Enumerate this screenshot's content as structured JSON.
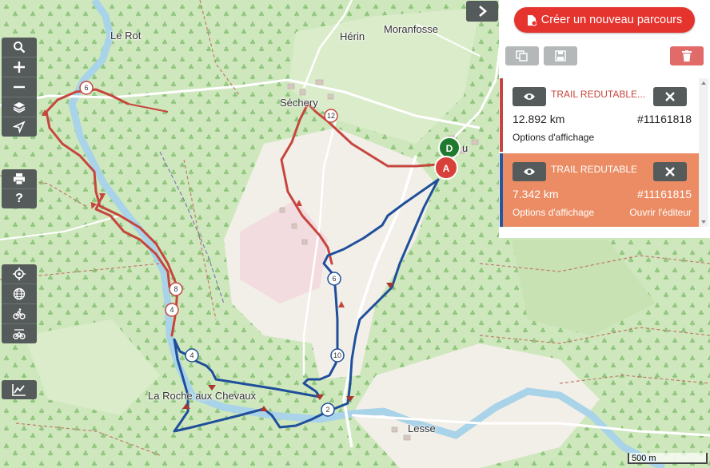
{
  "places": {
    "le_rot": "Le Rot",
    "herin": "Hérin",
    "moranfosse": "Moranfosse",
    "sechery": "Séchery",
    "la_roche": "La Roche aux Chevaux",
    "lesse": "Lesse",
    "u": "u"
  },
  "markers": {
    "start": "D",
    "end": "A"
  },
  "km_markers": {
    "red": [
      "6",
      "8",
      "12"
    ],
    "blue": [
      "2",
      "4",
      "6",
      "10"
    ],
    "shared": "4"
  },
  "toolbar": {
    "search": "search-icon",
    "zoom_in": "plus-icon",
    "zoom_out": "minus-icon",
    "layers": "layers-icon",
    "locate": "navigation-arrow-icon",
    "print": "printer-icon",
    "help": "?",
    "target": "crosshair-icon",
    "globe": "globe-icon",
    "bike1": "bike-icon",
    "bike2": "bike-alt-icon",
    "chart": "chart-icon"
  },
  "panel": {
    "create_label": "Créer un nouveau parcours",
    "routes": [
      {
        "name": "TRAIL REDUTABLE...",
        "distance": "12.892 km",
        "id": "#11161818",
        "options": "Options d'affichage",
        "color": "#c6463e"
      },
      {
        "name": "TRAIL REDUTABLE",
        "distance": "7.342 km",
        "id": "#11161815",
        "options": "Options d'affichage",
        "editor": "Ouvrir l'éditeur",
        "color": "#2556a0"
      }
    ]
  },
  "scale": "500 m",
  "colors": {
    "red_route": "#c6463e",
    "blue_route": "#1f4f9a",
    "accent": "#e5332e",
    "forest": "#d9ecc6",
    "field": "#f2efe9"
  }
}
